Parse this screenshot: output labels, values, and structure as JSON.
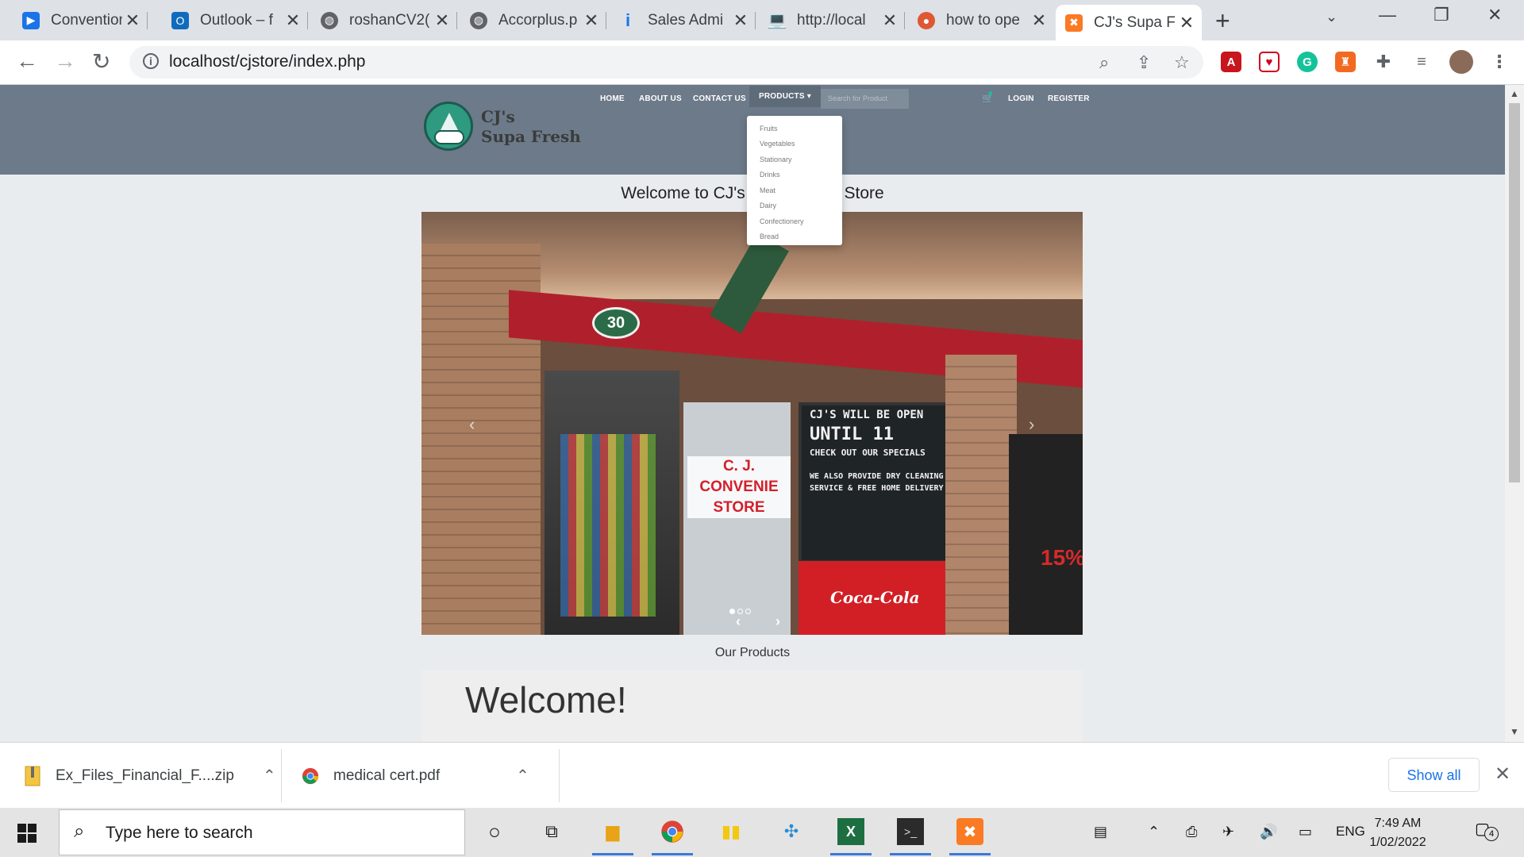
{
  "browser": {
    "tabs": [
      {
        "title": "Convention",
        "icon": "video-icon",
        "color": "#1a73e8"
      },
      {
        "title": "Outlook – f",
        "icon": "outlook-icon",
        "color": "#0f6cbd"
      },
      {
        "title": "roshanCV2(",
        "icon": "globe-icon",
        "color": "#5f6368"
      },
      {
        "title": "Accorplus.p",
        "icon": "globe-icon",
        "color": "#5f6368"
      },
      {
        "title": "Sales Admi",
        "icon": "info-icon",
        "color": "#1a73e8"
      },
      {
        "title": "http://local",
        "icon": "laptop-icon",
        "color": "#3c4043"
      },
      {
        "title": "how to ope",
        "icon": "duckduckgo-icon",
        "color": "#de5833"
      },
      {
        "title": "CJ's Supa F",
        "icon": "xampp-icon",
        "color": "#fb7a24",
        "active": true
      }
    ],
    "url": "localhost/cjstore/index.php"
  },
  "site": {
    "nav": {
      "home": "HOME",
      "about": "ABOUT US",
      "contact": "CONTACT US",
      "products": "PRODUCTS",
      "login": "LOGIN",
      "register": "REGISTER"
    },
    "search_placeholder": "Search for Product",
    "logo_line1": "CJ's",
    "logo_line2": "Supa Fresh",
    "dropdown": [
      "Fruits",
      "Vegetables",
      "Stationary",
      "Drinks",
      "Meat",
      "Dairy",
      "Confectionery",
      "Bread"
    ],
    "welcome_left": "Welcome to CJ's",
    "welcome_right": "Store",
    "carousel": {
      "slide_count": 3,
      "active_slide": 1,
      "photo_text": {
        "number": "30",
        "store_sign_1": "C. J.",
        "store_sign_2": "CONVENIE",
        "store_sign_3": "STORE",
        "board_1": "CJ'S WILL BE OPEN",
        "board_2": "UNTIL 11",
        "board_3": "CHECK OUT OUR SPECIALS",
        "board_4": "WE ALSO PROVIDE DRY CLEANING",
        "board_5": "SERVICE & FREE HOME DELIVERY",
        "coke": "Coca-Cola",
        "board_right": "15%"
      }
    },
    "our_products": "Our Products",
    "jumbotron_title": "Welcome!"
  },
  "downloads": {
    "items": [
      {
        "name": "Ex_Files_Financial_F....zip",
        "icon": "zip-icon"
      },
      {
        "name": "medical cert.pdf",
        "icon": "chrome-icon"
      }
    ],
    "show_all": "Show all"
  },
  "taskbar": {
    "search_placeholder": "Type here to search",
    "language": "ENG",
    "time": "7:49 AM",
    "date": "1/02/2022",
    "notifications": "4"
  }
}
